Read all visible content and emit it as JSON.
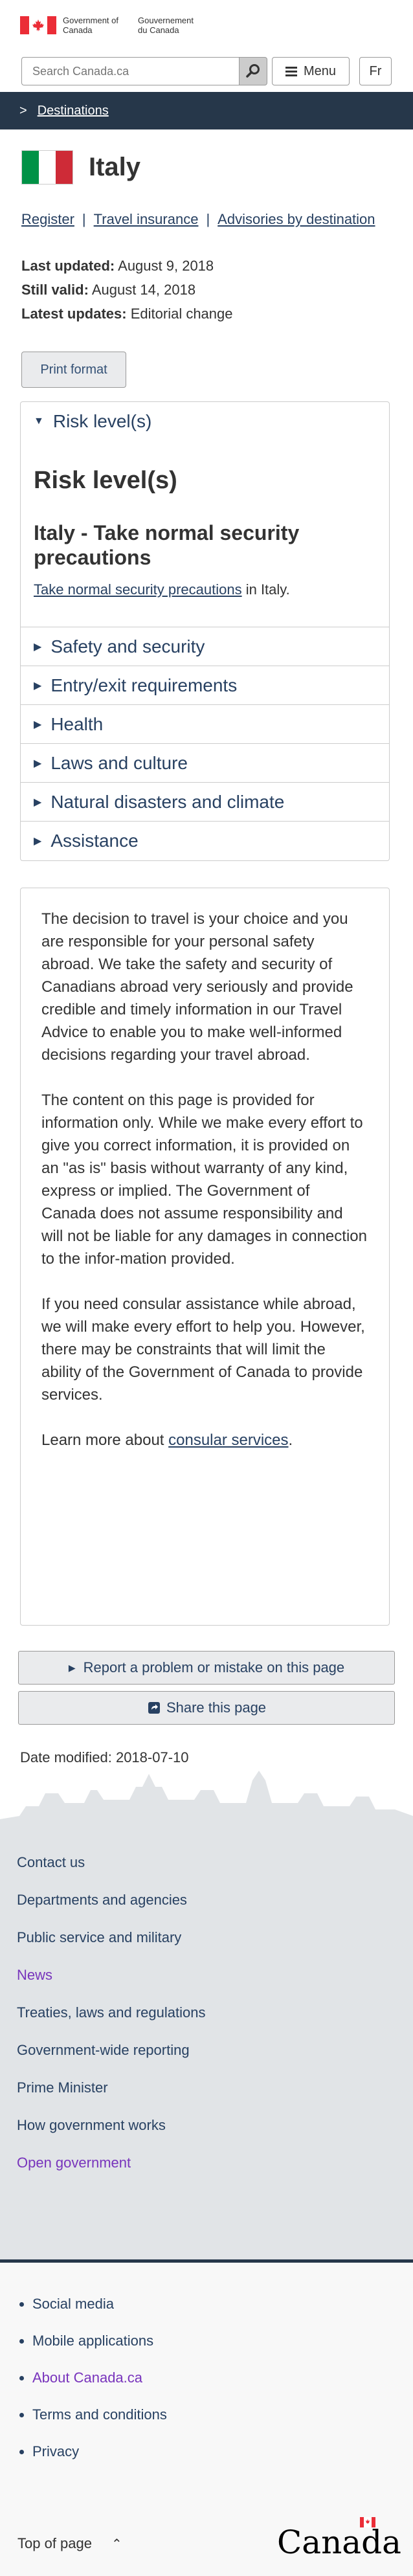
{
  "header": {
    "gov_en": "Government of Canada",
    "gov_fr": "Gouvernement du Canada",
    "search_placeholder": "Search Canada.ca",
    "menu_label": "Menu",
    "lang_label": "Fr"
  },
  "breadcrumb": {
    "chevron": ">",
    "item": "Destinations"
  },
  "page": {
    "title": "Italy",
    "flag_colors": [
      "#009246",
      "#ffffff",
      "#ce2b37"
    ],
    "links": [
      "Register",
      "Travel insurance",
      "Advisories by destination"
    ],
    "last_updated_label": "Last updated:",
    "last_updated_value": "August 9, 2018",
    "still_valid_label": "Still valid:",
    "still_valid_value": "August 14, 2018",
    "latest_updates_label": "Latest updates:",
    "latest_updates_value": "Editorial change",
    "print_label": "Print format"
  },
  "accordion": {
    "open_label": "Risk level(s)",
    "heading": "Risk level(s)",
    "subheading": "Italy - Take normal security precautions",
    "body_link": "Take normal security precautions",
    "body_suffix": " in Italy.",
    "items": [
      "Safety and security",
      "Entry/exit requirements",
      "Health",
      "Laws and culture",
      "Natural disasters and climate",
      "Assistance"
    ]
  },
  "disclaimer": {
    "p1": "The decision to travel is your choice and you are responsible for your personal safety abroad. We take the safety and security of Canadians abroad very seriously and provide credible and timely information in our Travel Advice to enable you to make well-informed decisions regarding your travel abroad.",
    "p2": "The content on this page is provided for information only. While we make every effort to give you correct information, it is provided on an \"as is\" basis without warranty of any kind, express or implied. The Government of Canada does not assume responsibility and will not be liable for any damages in connection to the infor-mation provided.",
    "p3": "If you need consular assistance while abroad, we will make every effort to help you. However, there may be constraints that will limit the ability of the Government of Canada to provide services.",
    "p4_prefix": "Learn more about ",
    "p4_link": "consular services",
    "p4_suffix": "."
  },
  "report_label": "Report a problem or mistake on this page",
  "share_label": "Share this page",
  "date_modified": "Date modified: 2018-07-10",
  "footer_main": [
    "Contact us",
    "Departments and agencies",
    "Public service and military",
    "News",
    "Treaties, laws and regulations",
    "Government-wide reporting",
    "Prime Minister",
    "How government works",
    "Open government"
  ],
  "footer_sub": [
    "Social media",
    "Mobile applications",
    "About Canada.ca",
    "Terms and conditions",
    "Privacy"
  ],
  "top_of_page": "Top of page",
  "wordmark": "Canada"
}
